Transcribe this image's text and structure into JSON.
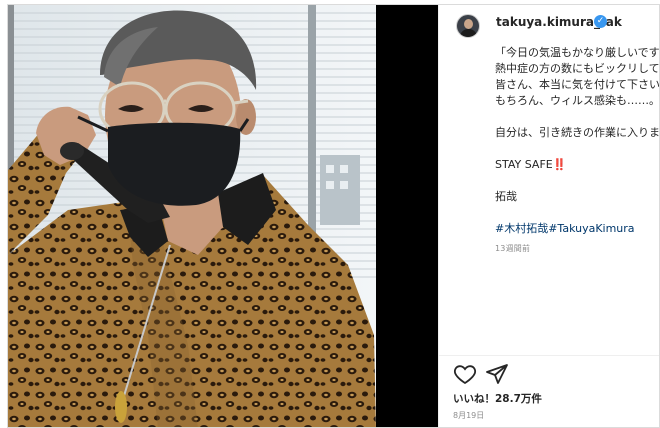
{
  "post": {
    "username": "takuya.kimura_tak",
    "verified_badge": "verified-icon",
    "caption_lines": [
      "「今日の気温もかなり厳しいですね〜！",
      "熱中症の方の数にもビックリしてます。",
      "皆さん、本当に気を付けて下さい！",
      "もちろん、ウィルス感染も……。",
      "自分は、引き続きの作業に入ります👊🐈」",
      "STAY SAFE‼️",
      "拓哉"
    ],
    "hashtags": "#木村拓哉#TakuyaKimura",
    "time_ago": "13週間前",
    "likes": "いいね！28.7万件",
    "date": "8月19日"
  },
  "icons": {
    "like": "heart-icon",
    "share": "paper-plane-icon"
  },
  "colors": {
    "text": "#262626",
    "secondary": "#8e8e8e",
    "hashtag": "#00376b",
    "verified": "#3897f0",
    "photo_background": "#000000"
  }
}
